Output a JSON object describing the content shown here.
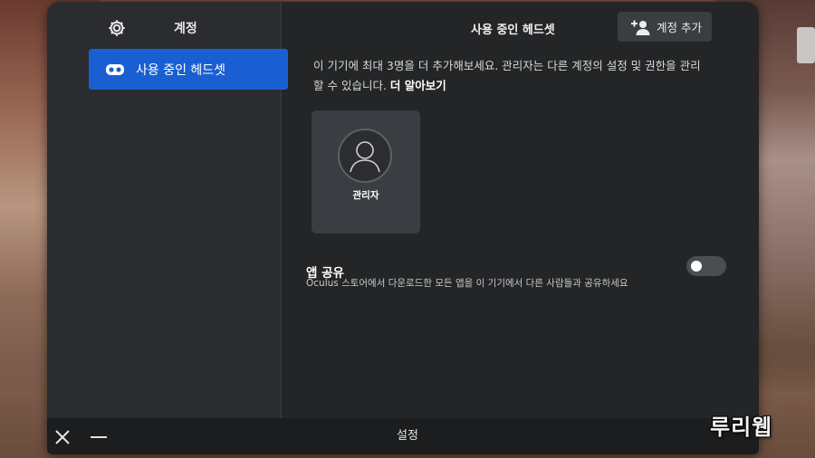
{
  "sidebar": {
    "title": "계정",
    "icon": "gear-icon",
    "items": [
      {
        "label": "사용 중인 헤드셋",
        "icon": "headset-icon",
        "active": true
      }
    ]
  },
  "content": {
    "title": "사용 중인 헤드셋",
    "add_account_button": {
      "label": "계정 추가",
      "icon": "add-user-icon"
    },
    "description": "이 기기에 최대 3명을 더 추가해보세요. 관리자는 다른 계정의 설정 및 권한을 관리할 수 있습니다.",
    "learn_more": "더 알아보기",
    "users": [
      {
        "name": "관리자",
        "icon": "user-avatar-icon"
      }
    ],
    "app_share": {
      "title": "앱 공유",
      "description": "Oculus 스토어에서 다운로드한 모든 앱을 이 기기에서 다른 사람들과 공유하세요",
      "enabled": false
    }
  },
  "bottom_bar": {
    "title": "설정",
    "close_icon": "close-icon",
    "minimize_icon": "minimize-icon"
  },
  "watermark": "루리웹",
  "colors": {
    "accent": "#1a5fd1",
    "panel": "#232527",
    "sidebar": "#2a2c2f"
  }
}
